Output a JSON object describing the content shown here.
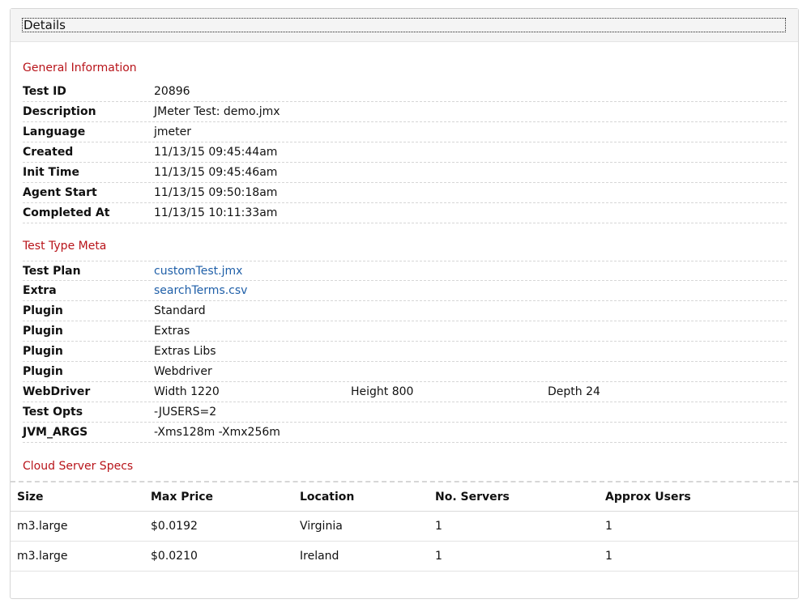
{
  "panel": {
    "title": "Details"
  },
  "general": {
    "title": "General Information",
    "rows": [
      {
        "key": "Test ID",
        "value": "20896"
      },
      {
        "key": "Description",
        "value": "JMeter Test: demo.jmx"
      },
      {
        "key": "Language",
        "value": "jmeter"
      },
      {
        "key": "Created",
        "value": "11/13/15 09:45:44am"
      },
      {
        "key": "Init Time",
        "value": "11/13/15 09:45:46am"
      },
      {
        "key": "Agent Start",
        "value": "11/13/15 09:50:18am"
      },
      {
        "key": "Completed At",
        "value": "11/13/15 10:11:33am"
      }
    ]
  },
  "meta": {
    "title": "Test Type Meta",
    "test_plan": {
      "key": "Test Plan",
      "value": "customTest.jmx"
    },
    "extra": {
      "key": "Extra",
      "value": "searchTerms.csv"
    },
    "plugins": [
      {
        "key": "Plugin",
        "value": "Standard"
      },
      {
        "key": "Plugin",
        "value": "Extras"
      },
      {
        "key": "Plugin",
        "value": "Extras Libs"
      },
      {
        "key": "Plugin",
        "value": "Webdriver"
      }
    ],
    "webdriver": {
      "key": "WebDriver",
      "width": "Width 1220",
      "height": "Height 800",
      "depth": "Depth 24"
    },
    "test_opts": {
      "key": "Test Opts",
      "value": "-JUSERS=2"
    },
    "jvm_args": {
      "key": "JVM_ARGS",
      "value": "-Xms128m -Xmx256m"
    }
  },
  "cloud": {
    "title": "Cloud Server Specs",
    "headers": {
      "size": "Size",
      "price": "Max Price",
      "location": "Location",
      "servers": "No. Servers",
      "users": "Approx Users"
    },
    "rows": [
      {
        "size": "m3.large",
        "price": "$0.0192",
        "location": "Virginia",
        "servers": "1",
        "users": "1"
      },
      {
        "size": "m3.large",
        "price": "$0.0210",
        "location": "Ireland",
        "servers": "1",
        "users": "1"
      }
    ]
  },
  "colors": {
    "section_title": "#b8141a",
    "link": "#1f5fa8"
  }
}
